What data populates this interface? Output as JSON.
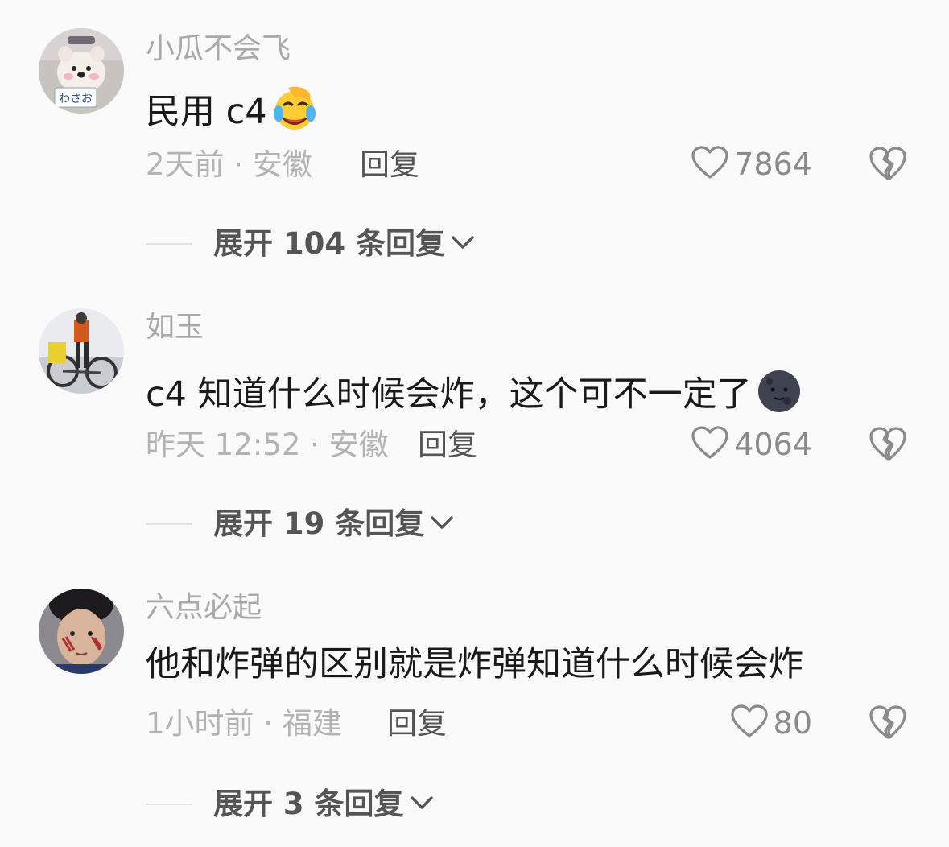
{
  "comments": [
    {
      "username": "小瓜不会飞",
      "content": "民用 c4",
      "emoji": "laughing-crying-emoji",
      "meta": "2天前 · 安徽",
      "reply_label": "回复",
      "likes": "7864",
      "expand_label": "展开 104 条回复"
    },
    {
      "username": "如玉",
      "content": "c4 知道什么时候会炸，这个可不一定了",
      "emoji": "new-moon-face-emoji",
      "meta": "昨天 12:52 · 安徽",
      "reply_label": "回复",
      "likes": "4064",
      "expand_label": "展开 19 条回复"
    },
    {
      "username": "六点必起",
      "content": "他和炸弹的区别就是炸弹知道什么时候会炸",
      "emoji": "",
      "meta": "1小时前 · 福建",
      "reply_label": "回复",
      "likes": "80",
      "expand_label": "展开 3 条回复"
    }
  ],
  "icons": {
    "like": "heart-outline-icon",
    "dislike": "broken-heart-icon",
    "expand": "chevron-down-icon"
  },
  "colors": {
    "background": "#fafafa",
    "username": "#a9a9a9",
    "content": "#1a1a1a",
    "meta": "#b3b3b3",
    "reply": "#555555"
  }
}
